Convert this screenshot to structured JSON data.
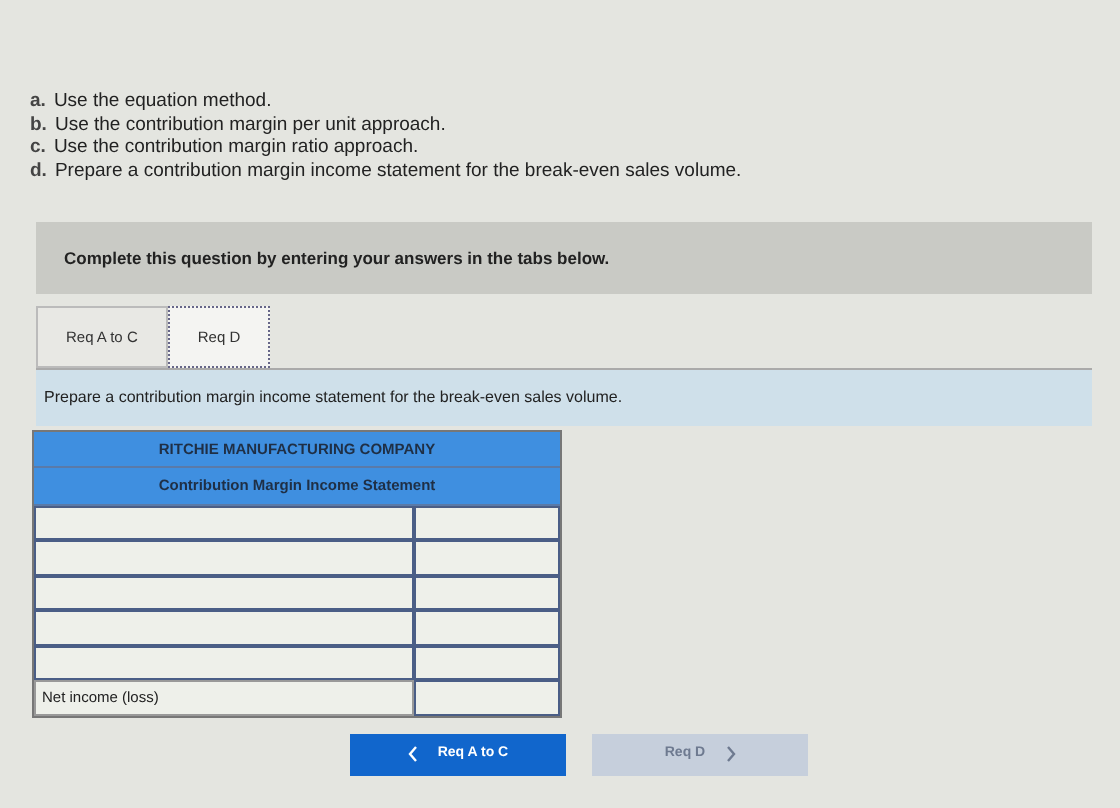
{
  "requirements": [
    {
      "letter": "a.",
      "text": "Use the equation method."
    },
    {
      "letter": "b.",
      "text": "Use the contribution margin per unit approach."
    },
    {
      "letter": "c.",
      "text": "Use the contribution margin ratio approach."
    },
    {
      "letter": "d.",
      "text": "Prepare a contribution margin income statement for the break-even sales volume."
    }
  ],
  "instruction": "Complete this question by entering your answers in the tabs below.",
  "tabs": [
    {
      "label": "Req A to C",
      "selected": false
    },
    {
      "label": "Req D",
      "selected": true
    }
  ],
  "prompt": "Prepare a contribution margin income statement for the break-even sales volume.",
  "statement": {
    "company": "RITCHIE MANUFACTURING COMPANY",
    "title": "Contribution Margin Income Statement",
    "rows": [
      {
        "kind": "input"
      },
      {
        "kind": "input"
      },
      {
        "kind": "input"
      },
      {
        "kind": "input"
      },
      {
        "kind": "input"
      },
      {
        "kind": "total",
        "label": "Net income (loss)"
      }
    ]
  },
  "nav": [
    {
      "label": "Req A to C",
      "kind": "prev",
      "disabled": false
    },
    {
      "label": "Req D",
      "kind": "next",
      "disabled": true
    }
  ]
}
